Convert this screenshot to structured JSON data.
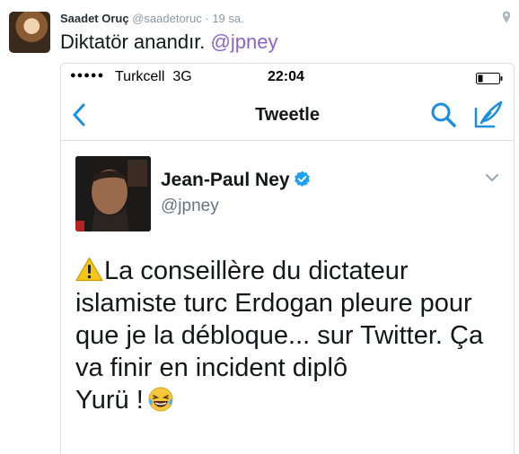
{
  "tweet": {
    "author_name": "Saadet Oruç",
    "author_handle": "@saadetoruc",
    "separator": " · ",
    "time": "19 sa.",
    "text_main": "Diktatör anandır. ",
    "mention": "@jpney"
  },
  "phone": {
    "signal": "●●●●●",
    "carrier": "Turkcell",
    "network": "3G",
    "clock": "22:04",
    "nav_title": "Tweetle"
  },
  "quoted": {
    "name": "Jean-Paul Ney",
    "handle": "@jpney",
    "lines": [
      "La conseillère du dictateur",
      "islamiste turc Erdogan pleure pour",
      "que je la débloque... sur Twitter. Ça",
      "va finir en incident diplô",
      "Yurü !"
    ]
  },
  "colors": {
    "mention": "#8b63c9",
    "ios_blue": "#1a8fe0",
    "verified": "#1da1f2",
    "warning": "#f5c518"
  },
  "icons": [
    "location-icon",
    "back-chevron-icon",
    "search-icon",
    "compose-icon",
    "verified-icon",
    "chevron-down-icon",
    "warning-icon",
    "laughing-tears-icon"
  ]
}
